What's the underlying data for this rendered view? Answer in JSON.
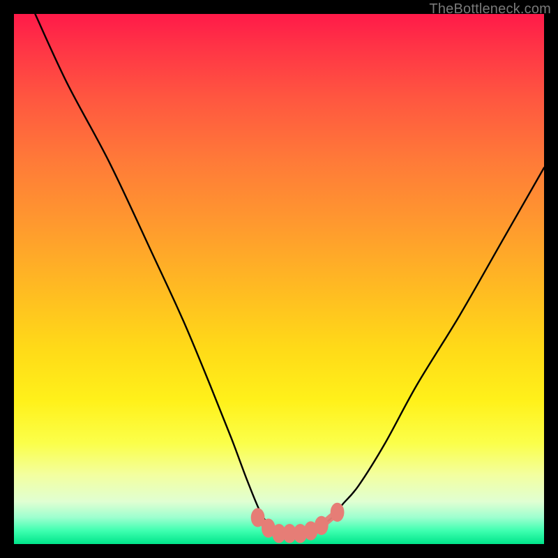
{
  "watermark": "TheBottleneck.com",
  "chart_data": {
    "type": "line",
    "title": "",
    "xlabel": "",
    "ylabel": "",
    "xlim": [
      0,
      100
    ],
    "ylim": [
      0,
      100
    ],
    "grid": false,
    "legend": false,
    "series": [
      {
        "name": "bottleneck-curve",
        "x": [
          4,
          10,
          18,
          26,
          32,
          37,
          41,
          44,
          46.5,
          48.5,
          50,
          52,
          54,
          56,
          58,
          60,
          62,
          65,
          70,
          76,
          84,
          92,
          100
        ],
        "y": [
          100,
          87,
          72,
          55,
          42,
          30,
          20,
          12,
          6,
          3,
          2,
          2,
          2,
          2.5,
          3.5,
          5,
          7.5,
          11,
          19,
          30,
          43,
          57,
          71
        ]
      }
    ],
    "markers": {
      "name": "bottom-marker-strip",
      "color": "#e67d76",
      "x": [
        46,
        48,
        50,
        52,
        54,
        56,
        58,
        61
      ],
      "y": [
        5,
        3,
        2,
        2,
        2,
        2.5,
        3.5,
        6
      ]
    },
    "background_gradient": {
      "top": "#ff1a49",
      "mid": "#ffe018",
      "bottom": "#00e58a"
    }
  }
}
